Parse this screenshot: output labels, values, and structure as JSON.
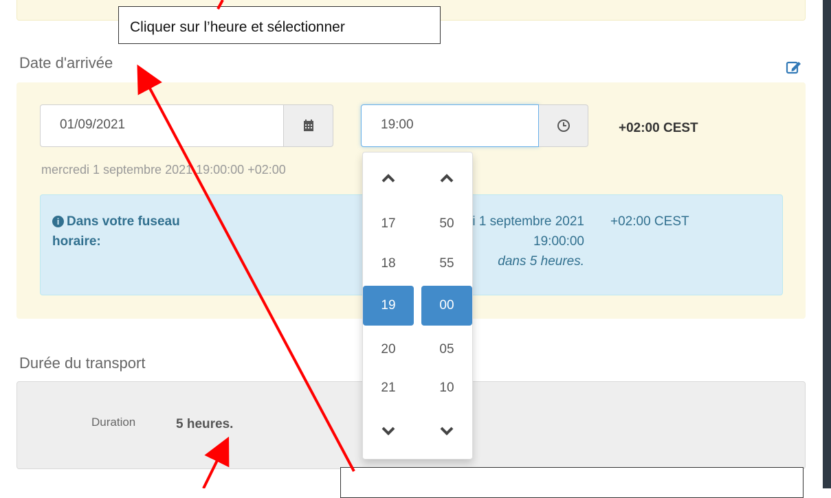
{
  "callouts": {
    "top": "Cliquer sur l’heure et sélectionner",
    "bottom": ""
  },
  "arrival": {
    "title": "Date d'arrivée",
    "edit_icon": "edit-icon",
    "date_value": "01/09/2021",
    "time_value": "19:00",
    "timezone": "+02:00 CEST",
    "hint": "mercredi 1 septembre 2021 19:00:00 +02:00",
    "info": {
      "label_line1": "Dans votre fuseau",
      "label_line2": "horaire:",
      "date_text": "mercredi 1 septembre 2021",
      "time_text": "19:00:00",
      "relative": "dans 5 heures.",
      "timezone": "+02:00 CEST"
    }
  },
  "time_picker": {
    "hours": [
      "17",
      "18",
      "19",
      "20",
      "21"
    ],
    "minutes": [
      "50",
      "55",
      "00",
      "05",
      "10"
    ],
    "selected_hour": "19",
    "selected_minute": "00"
  },
  "transport": {
    "title": "Durée du transport",
    "duration_label": "Duration",
    "duration_value": "5 heures."
  },
  "colors": {
    "accent": "#428bca",
    "arrow": "#ff0000",
    "panel_yellow": "#fcf8e3",
    "info_blue": "#d9edf7"
  }
}
